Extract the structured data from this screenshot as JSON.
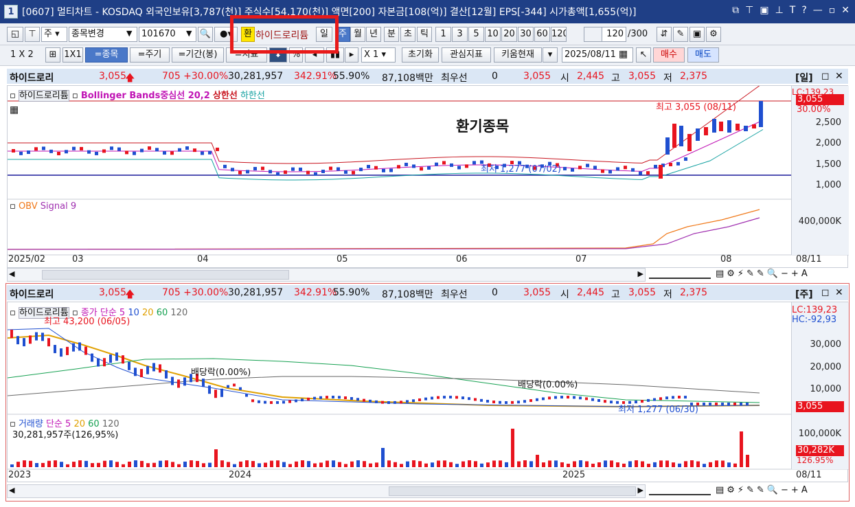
{
  "window": {
    "num": "1",
    "title": "[0607] 멀티차트 - KOSDAQ 외국인보유[3,787(천)] 주식수[54,170(천)] 액면[200] 자본금[108(억)] 결산[12월] EPS[-344] 시가총액[1,655(억)]"
  },
  "toolbar1": {
    "period_type": "주",
    "stock_change": "종목변경",
    "code": "101670",
    "fx_label": "환",
    "stock_name": "하이드로리튬",
    "day": "일",
    "week": "주",
    "month": "월",
    "year": "년",
    "minute": "분",
    "second": "초",
    "tick": "틱",
    "nums": [
      "1",
      "3",
      "5",
      "10",
      "20",
      "30",
      "60",
      "120"
    ],
    "count": "120",
    "total": "/300"
  },
  "toolbar2": {
    "layout1": "1 X 2",
    "layout2": "1X1",
    "by_stock": "=종목",
    "by_period": "=주기",
    "by_range": "=기간(봉)",
    "by_indicator": "=지표",
    "mult": "X 1",
    "reset": "초기화",
    "interest": "관심지표",
    "kiwoom": "키움현재",
    "date": "2025/08/11",
    "buy": "매수",
    "sell": "매도"
  },
  "info_top": {
    "name": "하이드로리",
    "price": "3,055",
    "change": "705 +30.00%",
    "volume": "30,281,957",
    "vol_rate": "342.91%",
    "ratio": "55.90%",
    "amount": "87,108백만",
    "order": "최우선",
    "order_val": "0",
    "ask": "3,055",
    "open_label": "시",
    "open": "2,445",
    "high_label": "고",
    "high": "3,055",
    "low_label": "저",
    "low": "2,375",
    "period": "[일]"
  },
  "chart_top": {
    "legend_name": "하이드로리튬",
    "indicator": "Bollinger Bands중심선 20,2",
    "upper": "상한선",
    "lower": "하한선",
    "annotation": "환기종목",
    "high_note": "최고 3,055 (08/11)",
    "low_note": "최저 1,277 (07/02)",
    "lc": "LC:139,23",
    "price_tag": "3,055",
    "pct_tag": "30.00%",
    "yticks": [
      "2,500",
      "2,000",
      "1,500",
      "1,000"
    ],
    "obv_label": "OBV",
    "obv_signal": "Signal 9",
    "obv_tick": "400,000K",
    "xticks": [
      "2025/02",
      "03",
      "04",
      "05",
      "06",
      "07",
      "08",
      "08/11"
    ]
  },
  "info_bottom": {
    "name": "하이드로리",
    "price": "3,055",
    "change": "705 +30.00%",
    "volume": "30,281,957",
    "vol_rate": "342.91%",
    "ratio": "55.90%",
    "amount": "87,108백만",
    "order": "최우선",
    "order_val": "0",
    "ask": "3,055",
    "open_label": "시",
    "open": "2,445",
    "high_label": "고",
    "high": "3,055",
    "low_label": "저",
    "low": "2,375",
    "period": "[주]"
  },
  "chart_bottom": {
    "legend_name": "하이드로리튬",
    "ma_label": "종가 단순 5",
    "ma10": "10",
    "ma20": "20",
    "ma60": "60",
    "ma120": "120",
    "high_note": "최고 43,200 (06/05)",
    "div1": "배당락(0.00%)",
    "div2": "배당락(0.00%)",
    "low_note": "최저 1,277 (06/30)",
    "lc": "LC:139,23",
    "hc": "HC:-92,93",
    "yticks": [
      "30,000",
      "20,000",
      "10,000"
    ],
    "price_tag": "3,055",
    "vol_label": "거래량",
    "vol_ma": "단순 5",
    "vol20": "20",
    "vol60": "60",
    "vol120": "120",
    "vol_value": "30,281,957주(126,95%)",
    "vol_tick": "100,000K",
    "vol_tag": "30,282K",
    "vol_pct": "126.95%",
    "xticks": [
      "2023",
      "2024",
      "2025",
      "08/11"
    ]
  },
  "colors": {
    "title_bg": "#1f3f86",
    "up": "#e8141e",
    "down": "#1f4fd0",
    "boll_mid": "#c015b5",
    "boll_upper": "#c8141e",
    "boll_lower": "#12a0a0",
    "obv": "#f07818",
    "signal": "#a030b0",
    "highlight": "#e81a1a"
  }
}
